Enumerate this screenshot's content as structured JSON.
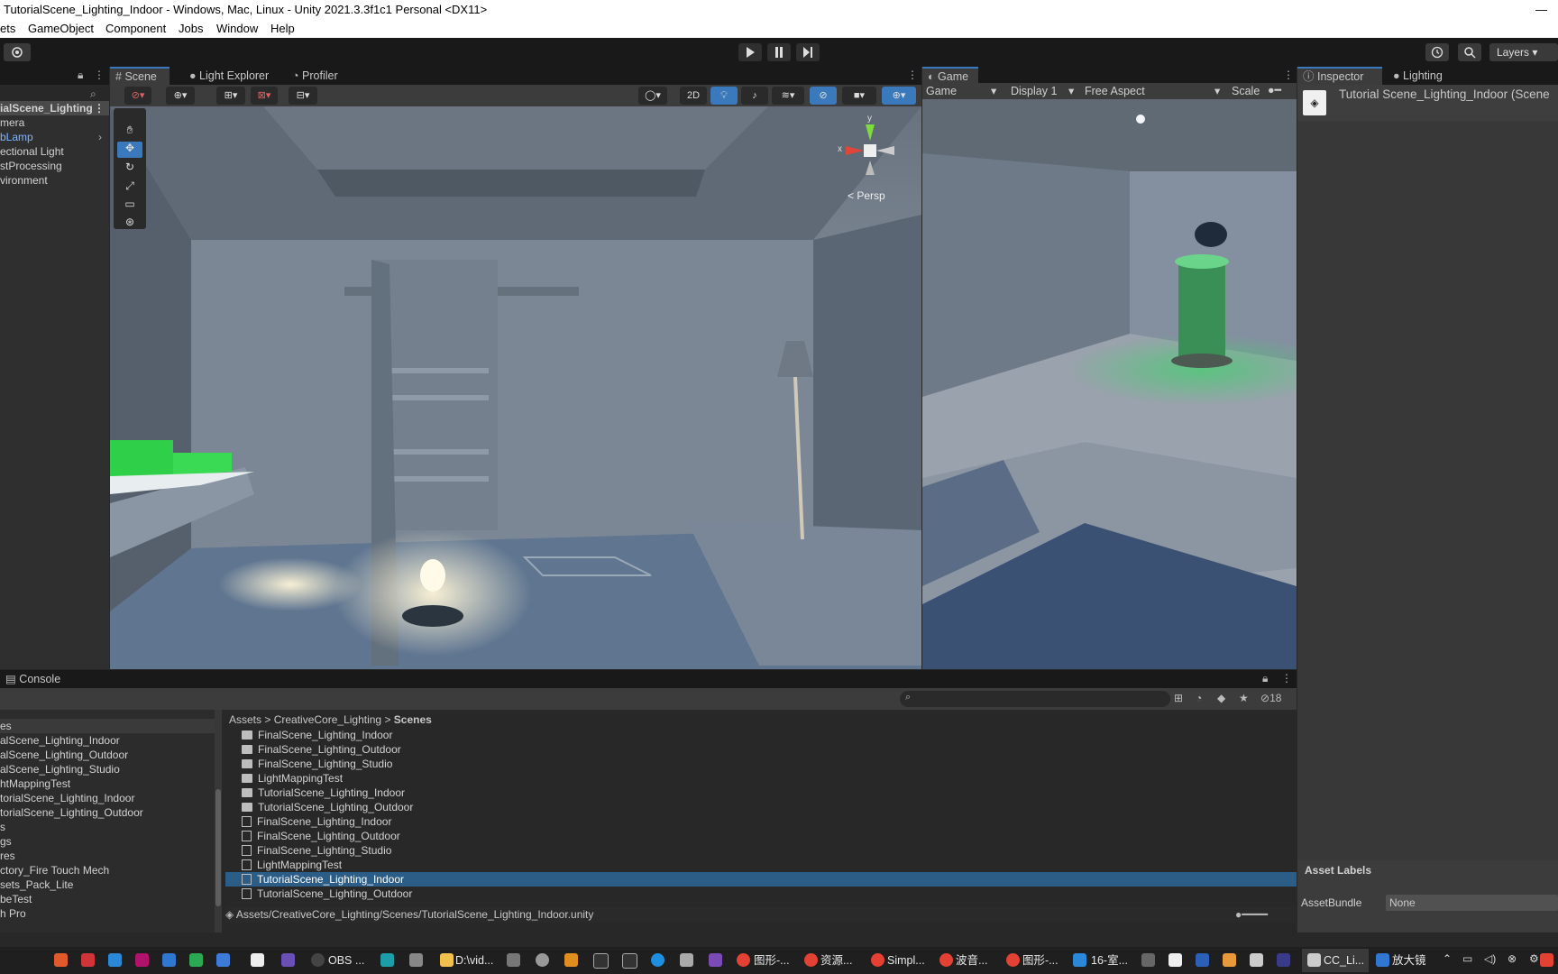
{
  "window": {
    "title": "TutorialScene_Lighting_Indoor - Windows, Mac, Linux - Unity 2021.3.3f1c1 Personal <DX11>",
    "minimize": "—"
  },
  "menu": [
    "ets",
    "GameObject",
    "Component",
    "Jobs",
    "Window",
    "Help"
  ],
  "toolbar": {
    "play_icon": "play-icon",
    "pause_icon": "pause-icon",
    "step_icon": "step-icon",
    "layers_label": "Layers"
  },
  "hierarchy": {
    "root": "ialScene_Lighting",
    "items": [
      "mera",
      "bLamp",
      "ectional Light",
      "stProcessing",
      "vironment"
    ]
  },
  "scene": {
    "tabs": [
      "Scene",
      "Light Explorer",
      "Profiler"
    ],
    "toggle_2d": "2D",
    "persp_label": "Persp",
    "gizmo_x": "x",
    "gizmo_y": "y"
  },
  "game": {
    "tab": "Game",
    "dropdowns": [
      "Game",
      "Display 1",
      "Free Aspect"
    ],
    "scale_label": "Scale"
  },
  "inspector": {
    "tabs": [
      "Inspector",
      "Lighting"
    ],
    "object_name": "Tutorial Scene_Lighting_Indoor (Scene",
    "asset_labels": "Asset Labels",
    "asset_bundle_label": "AssetBundle",
    "asset_bundle_value": "None"
  },
  "console": {
    "tab": "Console",
    "hidden_count": "18",
    "breadcrumb": [
      "Assets",
      "CreativeCore_Lighting",
      "Scenes"
    ],
    "tree": [
      "es",
      "alScene_Lighting_Indoor",
      "alScene_Lighting_Outdoor",
      "alScene_Lighting_Studio",
      "htMappingTest",
      "torialScene_Lighting_Indoor",
      "torialScene_Lighting_Outdoor",
      "s",
      "gs",
      "res",
      "ctory_Fire Touch Mech",
      "sets_Pack_Lite",
      "beTest",
      "h Pro"
    ],
    "files": [
      {
        "name": "FinalScene_Lighting_Indoor",
        "kind": "folder"
      },
      {
        "name": "FinalScene_Lighting_Outdoor",
        "kind": "folder"
      },
      {
        "name": "FinalScene_Lighting_Studio",
        "kind": "folder"
      },
      {
        "name": "LightMappingTest",
        "kind": "folder"
      },
      {
        "name": "TutorialScene_Lighting_Indoor",
        "kind": "folder"
      },
      {
        "name": "TutorialScene_Lighting_Outdoor",
        "kind": "folder"
      },
      {
        "name": "FinalScene_Lighting_Indoor",
        "kind": "scene"
      },
      {
        "name": "FinalScene_Lighting_Outdoor",
        "kind": "scene"
      },
      {
        "name": "FinalScene_Lighting_Studio",
        "kind": "scene"
      },
      {
        "name": "LightMappingTest",
        "kind": "scene"
      },
      {
        "name": "TutorialScene_Lighting_Indoor",
        "kind": "scene",
        "selected": true
      },
      {
        "name": "TutorialScene_Lighting_Outdoor",
        "kind": "scene"
      }
    ],
    "path": "Assets/CreativeCore_Lighting/Scenes/TutorialScene_Lighting_Indoor.unity"
  },
  "taskbar": {
    "items": [
      "OBS ...",
      "D:\\vid...",
      "图形-...",
      "资源...",
      "Simpl...",
      "波音...",
      "图形-...",
      "16-室...",
      "CC_Li...",
      "放大镜"
    ]
  },
  "colors": {
    "accent": "#3a79bb",
    "selection": "#2c5d87",
    "panel": "#383838",
    "header": "#191919"
  }
}
